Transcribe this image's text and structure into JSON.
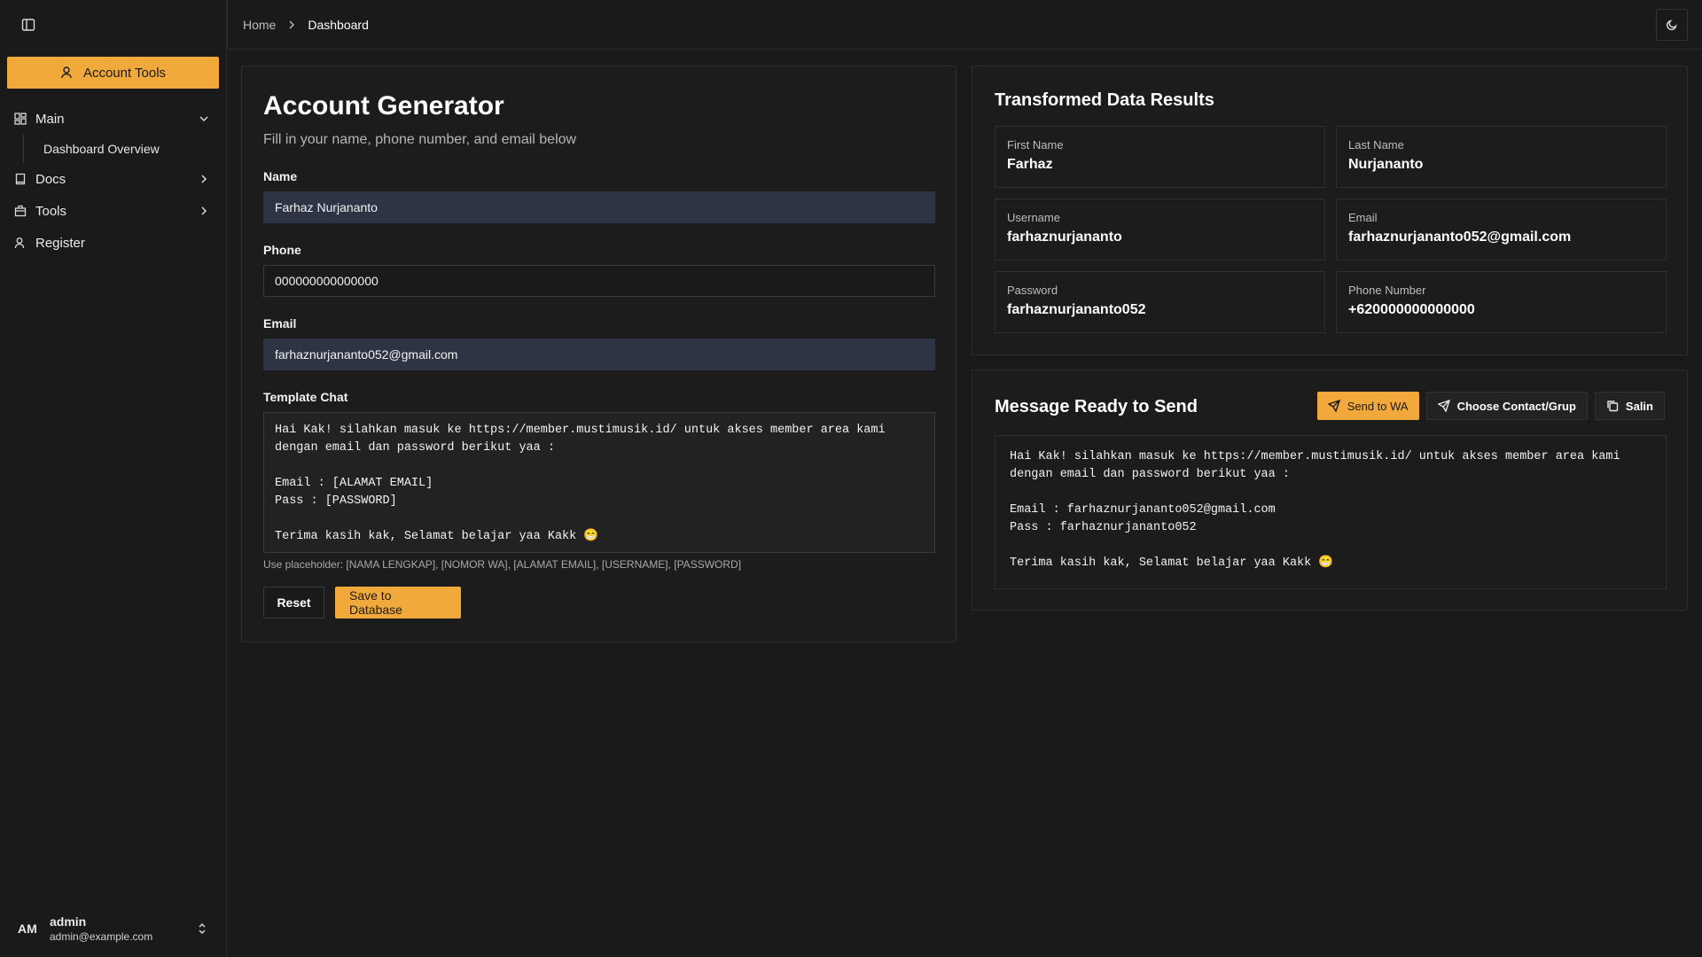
{
  "breadcrumb": {
    "home": "Home",
    "current": "Dashboard"
  },
  "sidebar": {
    "account_button": "Account Tools",
    "items": [
      {
        "label": "Main",
        "icon": "grid-icon",
        "expanded": true
      },
      {
        "label": "Docs",
        "icon": "book-icon"
      },
      {
        "label": "Tools",
        "icon": "package-icon"
      },
      {
        "label": "Register",
        "icon": "user-icon"
      }
    ],
    "sub_items": [
      "Dashboard Overview"
    ],
    "user": {
      "initials": "AM",
      "name": "admin",
      "email": "admin@example.com"
    }
  },
  "form": {
    "title": "Account Generator",
    "subtitle": "Fill in your name, phone number, and email below",
    "name_label": "Name",
    "name_value": "Farhaz Nurjananto",
    "phone_label": "Phone",
    "phone_value": "000000000000000",
    "email_label": "Email",
    "email_value": "farhaznurjananto052@gmail.com",
    "template_label": "Template Chat",
    "template_value": "Hai Kak! silahkan masuk ke https://member.mustimusik.id/ untuk akses member area kami dengan email dan password berikut yaa :\n\nEmail : [ALAMAT EMAIL]\nPass : [PASSWORD]\n\nTerima kasih kak, Selamat belajar yaa Kakk 😁",
    "hint": "Use placeholder: [NAMA LENGKAP], [NOMOR WA], [ALAMAT EMAIL], [USERNAME], [PASSWORD]",
    "reset_label": "Reset",
    "save_label": "Save to Database"
  },
  "results": {
    "title": "Transformed Data Results",
    "first_name_label": "First Name",
    "first_name": "Farhaz",
    "last_name_label": "Last Name",
    "last_name": "Nurjananto",
    "username_label": "Username",
    "username": "farhaznurjananto",
    "email_label": "Email",
    "email": "farhaznurjananto052@gmail.com",
    "password_label": "Password",
    "password": "farhaznurjananto052",
    "phone_label": "Phone Number",
    "phone": "+620000000000000"
  },
  "message": {
    "title": "Message Ready to Send",
    "send_wa_label": "Send to WA",
    "choose_contact_label": "Choose Contact/Grup",
    "copy_label": "Salin",
    "text": "Hai Kak! silahkan masuk ke https://member.mustimusik.id/ untuk akses member area kami dengan email dan password berikut yaa :\n\nEmail : farhaznurjananto052@gmail.com\nPass : farhaznurjananto052\n\nTerima kasih kak, Selamat belajar yaa Kakk 😁"
  },
  "colors": {
    "accent": "#f2a93b",
    "background": "#1a1a1a",
    "input_fill": "#2e3443"
  }
}
